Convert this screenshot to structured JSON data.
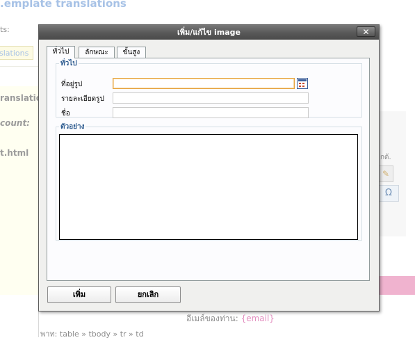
{
  "background": {
    "page_title": ".emplate translations",
    "subtitle": "ts:",
    "pill_label": "slations",
    "translation_label": "ranslation",
    "count_label": "count:",
    "file_label": "t.html",
    "editor_fragment": "กด้.",
    "email_label": "อีเมล์ของท่าน:",
    "email_var": "{email}",
    "path_prefix": "พาท:",
    "path": "table » tbody » tr » td",
    "special_char_glyph": "Ω",
    "edit_glyph": "✎"
  },
  "dialog": {
    "title": "เพิ่ม/แก้ไข image",
    "close_glyph": "✕",
    "tabs": [
      {
        "label": "ทั่วไป",
        "active": true
      },
      {
        "label": "ลักษณะ",
        "active": false
      },
      {
        "label": "ขั้นสูง",
        "active": false
      }
    ],
    "general": {
      "legend": "ทั่วไป",
      "fields": [
        {
          "label": "ที่อยู่รูป",
          "value": "",
          "focused": true
        },
        {
          "label": "รายละเอียดรูป",
          "value": ""
        },
        {
          "label": "ชื่อ",
          "value": ""
        }
      ],
      "browse_icon": "file-browser-icon"
    },
    "preview": {
      "legend": "ตัวอย่าง"
    },
    "buttons": {
      "insert": "เพิ่ม",
      "cancel": "ยกเลิก"
    }
  }
}
